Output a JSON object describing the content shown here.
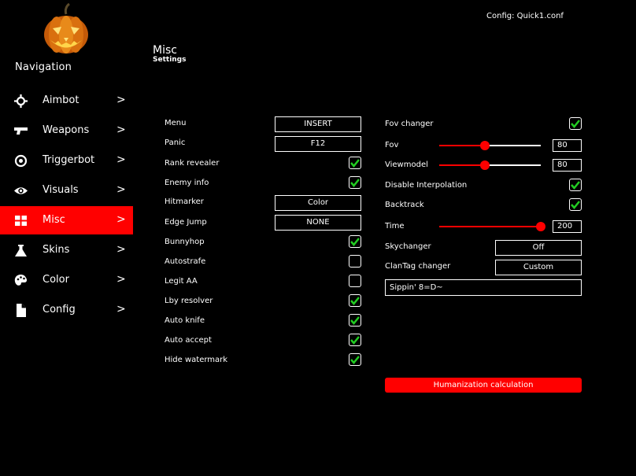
{
  "config_label": "Config: Quick1.conf",
  "nav": {
    "title": "Navigation",
    "items": [
      {
        "label": "Aimbot",
        "arrow": ">"
      },
      {
        "label": "Weapons",
        "arrow": ">"
      },
      {
        "label": "Triggerbot",
        "arrow": ">"
      },
      {
        "label": "Visuals",
        "arrow": ">"
      },
      {
        "label": "Misc",
        "arrow": ">"
      },
      {
        "label": "Skins",
        "arrow": ">"
      },
      {
        "label": "Color",
        "arrow": ">"
      },
      {
        "label": "Config",
        "arrow": ">"
      }
    ]
  },
  "page": {
    "title": "Misc",
    "subtitle": "Settings"
  },
  "left": {
    "menu": {
      "label": "Menu",
      "value": "INSERT"
    },
    "panic": {
      "label": "Panic",
      "value": "F12"
    },
    "rank_revealer": {
      "label": "Rank revealer",
      "checked": true
    },
    "enemy_info": {
      "label": "Enemy info",
      "checked": true
    },
    "hitmarker": {
      "label": "Hitmarker",
      "value": "Color"
    },
    "edge_jump": {
      "label": "Edge Jump",
      "value": "NONE"
    },
    "bunnyhop": {
      "label": "Bunnyhop",
      "checked": true
    },
    "autostrafe": {
      "label": "Autostrafe",
      "checked": false
    },
    "legit_aa": {
      "label": "Legit AA",
      "checked": false
    },
    "lby_resolver": {
      "label": "Lby resolver",
      "checked": true
    },
    "auto_knife": {
      "label": "Auto knife",
      "checked": true
    },
    "auto_accept": {
      "label": "Auto accept",
      "checked": true
    },
    "hide_watermark": {
      "label": "Hide watermark",
      "checked": true
    }
  },
  "right": {
    "fov_changer": {
      "label": "Fov changer",
      "checked": true
    },
    "fov": {
      "label": "Fov",
      "value": "80"
    },
    "viewmodel": {
      "label": "Viewmodel",
      "value": "80"
    },
    "disable_interp": {
      "label": "Disable Interpolation",
      "checked": true
    },
    "backtrack": {
      "label": "Backtrack",
      "checked": true
    },
    "time": {
      "label": "Time",
      "value": "200"
    },
    "skychanger": {
      "label": "Skychanger",
      "value": "Off"
    },
    "clantag": {
      "label": "ClanTag changer",
      "value": "Custom"
    },
    "clantag_text": "Sippin' 8=D~",
    "humanization_button": "Humanization calculation"
  },
  "colors": {
    "accent": "#ff0000",
    "check": "#22cc22",
    "background": "#000000"
  }
}
